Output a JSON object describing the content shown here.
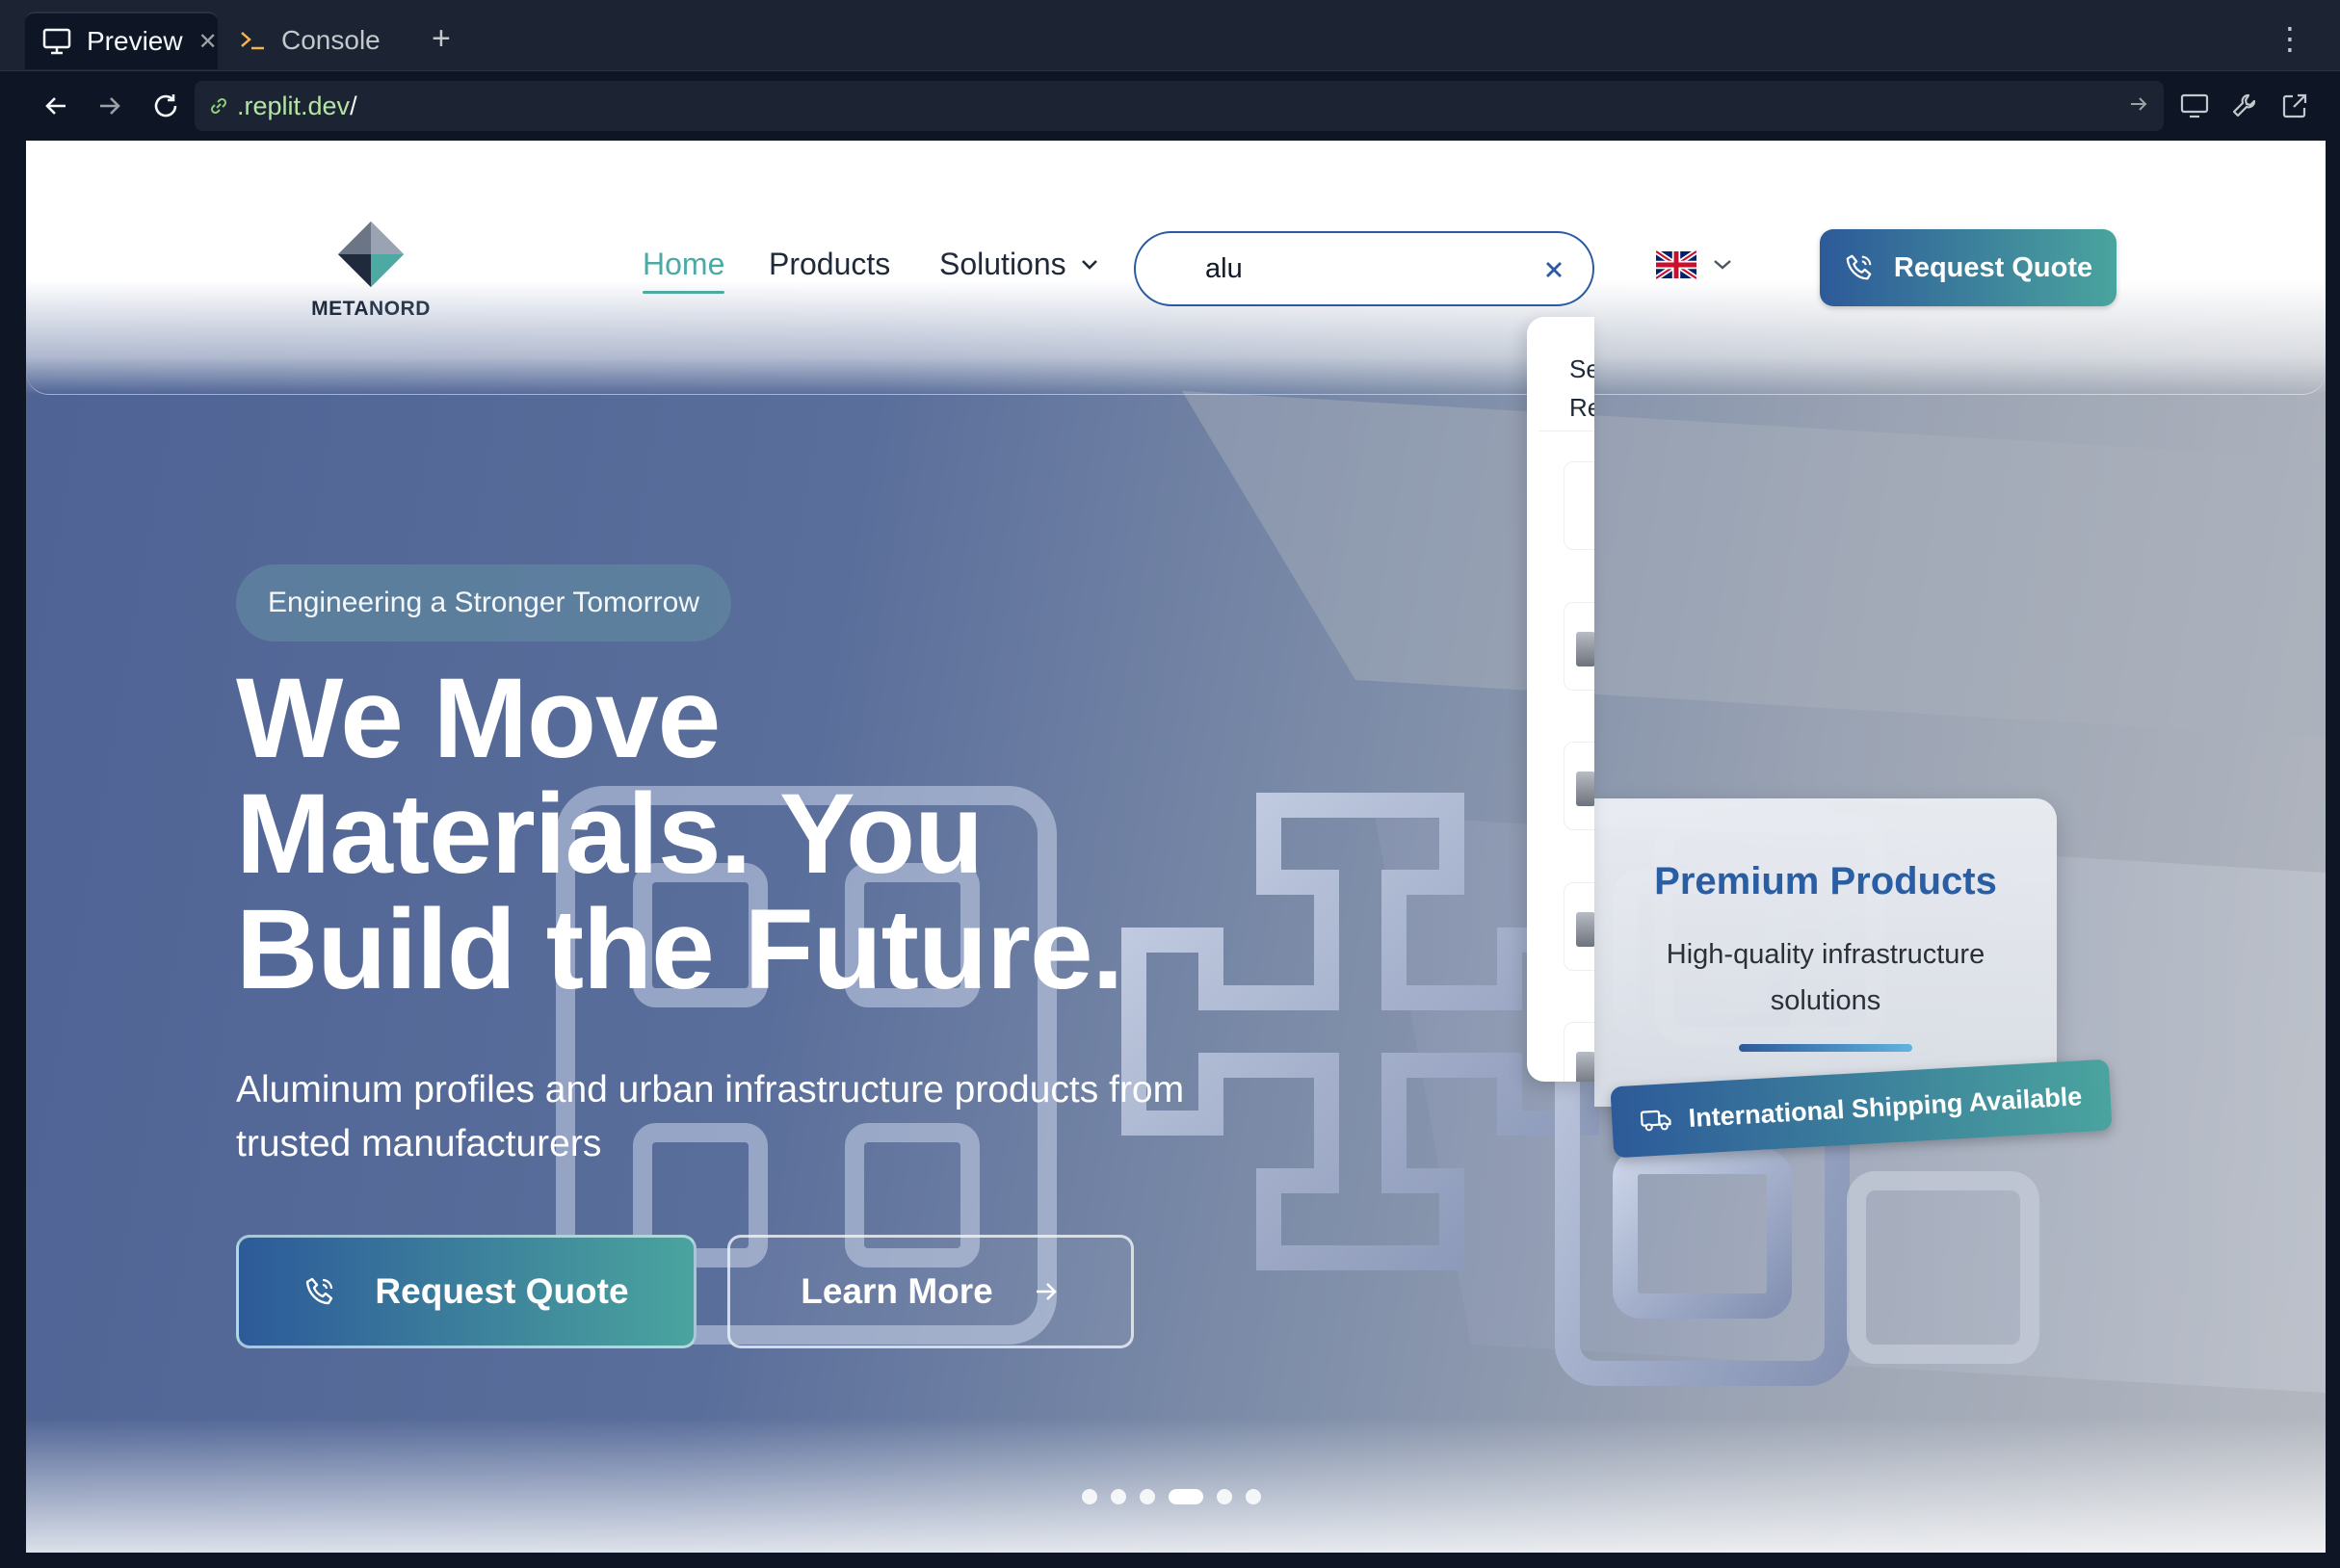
{
  "browser": {
    "tabs": [
      {
        "label": "Preview",
        "icon": "monitor-icon",
        "active": true
      },
      {
        "label": "Console",
        "icon": "terminal-icon",
        "active": false
      }
    ],
    "new_tab": "+",
    "url": ".replit.dev",
    "url_suffix": "/"
  },
  "site": {
    "logo": {
      "part1": "META",
      "part2": "NORD"
    },
    "nav": {
      "home": "Home",
      "products": "Products",
      "solutions": "Solutions"
    },
    "search": {
      "value": "alu"
    },
    "search_dropdown": {
      "title_line1": "Se",
      "title_line2": "Re"
    },
    "language": {
      "flag": "uk-flag-icon"
    },
    "header_cta": "Request Quote"
  },
  "hero": {
    "badge": "Engineering a Stronger Tomorrow",
    "headline": [
      "We Move",
      "Materials. You",
      "Build the Future."
    ],
    "subline": "Aluminum profiles and urban infrastructure products from trusted manufacturers",
    "primary_cta": "Request Quote",
    "secondary_cta": "Learn More",
    "card": {
      "title": "Premium Products",
      "desc": "High-quality infrastructure solutions"
    },
    "shipping_badge": "International Shipping Available",
    "carousel": {
      "count": 6,
      "active_index": 3
    }
  },
  "colors": {
    "accent": "#4caaa3",
    "brand_blue": "#2d5a99",
    "search_border": "#2b5aa3"
  }
}
